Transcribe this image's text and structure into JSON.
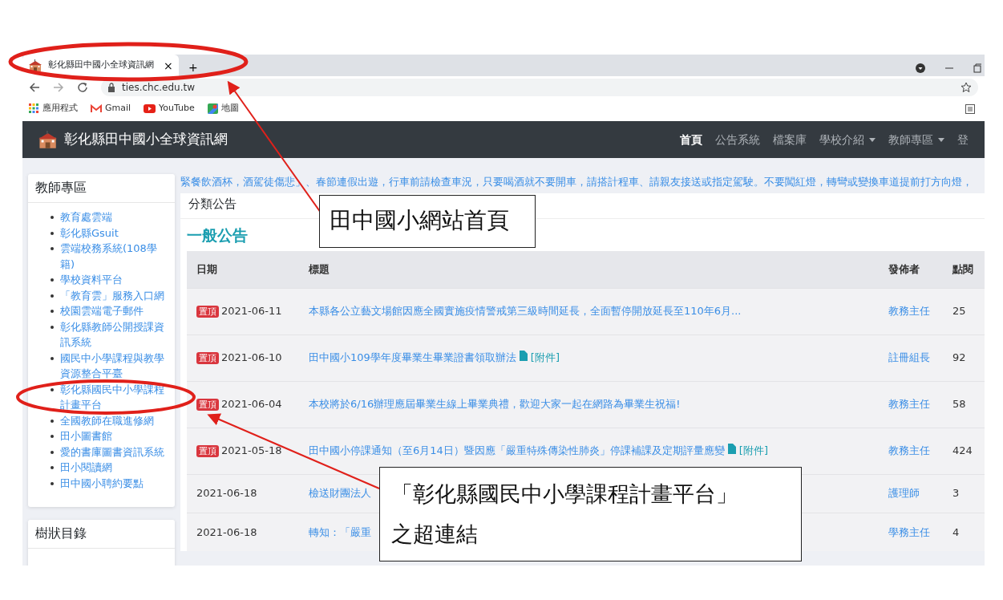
{
  "browser": {
    "tabs": [
      {
        "title": "彰化縣田中國小全球資訊網",
        "close": "×",
        "selected": true
      }
    ],
    "new_tab": "+",
    "address": "ties.chc.edu.tw",
    "bookmarks": [
      {
        "label": "應用程式",
        "kind": "apps"
      },
      {
        "label": "Gmail",
        "kind": "mail"
      },
      {
        "label": "YouTube",
        "kind": "video"
      },
      {
        "label": "地圖",
        "kind": "map"
      }
    ]
  },
  "navbar": {
    "brand": "彰化縣田中國小全球資訊網",
    "items": [
      {
        "label": "首頁",
        "active": true,
        "dropdown": false
      },
      {
        "label": "公告系統",
        "active": false,
        "dropdown": false
      },
      {
        "label": "檔案庫",
        "active": false,
        "dropdown": false
      },
      {
        "label": "學校介紹",
        "active": false,
        "dropdown": true
      },
      {
        "label": "教師專區",
        "active": false,
        "dropdown": true
      },
      {
        "label": "登",
        "active": false,
        "dropdown": false
      }
    ]
  },
  "sidebar": [
    {
      "title": "教師專區",
      "links": [
        "教育處雲端",
        "彰化縣Gsuit",
        "雲端校務系統(108學籍)",
        "學校資料平台",
        "「教育雲」服務入口網",
        "校園雲端電子郵件",
        "彰化縣教師公開授課資訊系統",
        "國民中小學課程與教學資源整合平臺",
        "彰化縣國民中小學課程計畫平台",
        "全國教師在職進修網",
        "田小圖書館",
        "愛的書庫圖書資訊系統",
        "田小閱讀網",
        "田中國小聘約要點"
      ]
    },
    {
      "title": "樹狀目錄"
    }
  ],
  "marquee": "緊餐飲酒杯，酒駕徒傷悲」、春節連假出遊，行車前請檢查車況，只要喝酒就不要開車，請搭計程車、請親友接送或指定駕駛。不要闖紅燈，轉彎或變換車道提前打方向燈，",
  "card": {
    "header": "分類公告",
    "heading": "一般公告",
    "table": {
      "columns": [
        "日期",
        "標題",
        "發佈者",
        "點閱"
      ],
      "rows": [
        {
          "badge": "置頂",
          "date": "2021-06-11",
          "title": "本縣各公立藝文場館因應全國實施疫情警戒第三級時間延長，全面暫停開放延長至110年6月...",
          "publisher": "教務主任",
          "clicks": "25"
        },
        {
          "badge": "置頂",
          "date": "2021-06-10",
          "title": "田中國小109學年度畢業生畢業證書領取辦法",
          "attachment": "[附件]",
          "publisher": "註冊組長",
          "clicks": "92"
        },
        {
          "badge": "置頂",
          "date": "2021-06-04",
          "title": "本校將於6/16辦理應屆畢業生線上畢業典禮，歡迎大家一起在網路為畢業生祝福!",
          "publisher": "教務主任",
          "clicks": "58"
        },
        {
          "badge": "置頂",
          "date": "2021-05-18",
          "title": "田中國小停課通知（至6月14日）暨因應「嚴重特殊傳染性肺炎」停課補課及定期評量應變",
          "attachment": "[附件]",
          "publisher": "教務主任",
          "clicks": "424"
        },
        {
          "date": "2021-06-18",
          "title": "檢送財團法人",
          "publisher": "護理師",
          "clicks": "3"
        },
        {
          "date": "2021-06-18",
          "title": "轉知：「嚴重",
          "publisher": "學務主任",
          "clicks": "4"
        }
      ]
    }
  },
  "annotations": [
    {
      "kind": "callout",
      "text": "田中國小網站首頁"
    },
    {
      "kind": "callout",
      "text": "「彰化縣國民中小學課程計畫平台」之超連結"
    }
  ]
}
